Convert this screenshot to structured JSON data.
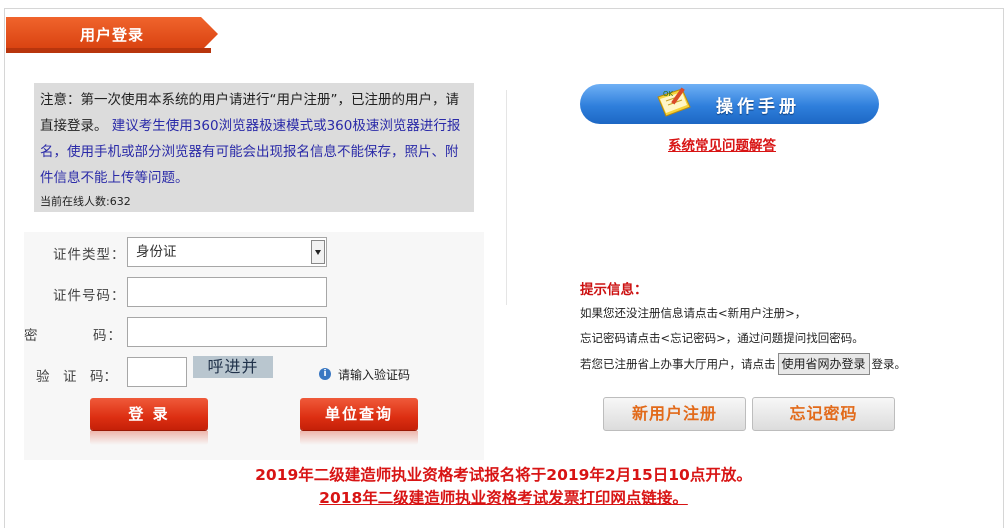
{
  "header": {
    "title": "用户登录"
  },
  "notice": {
    "text_black": "注意：第一次使用本系统的用户请进行“用户注册”，已注册的用户，请直接登录。",
    "text_blue": "建议考生使用360浏览器极速模式或360极速浏览器进行报名，使用手机或部分浏览器有可能会出现报名信息不能保存，照片、附件信息不能上传等问题。",
    "online": "当前在线人数:632"
  },
  "form": {
    "id_type_label": "证件类型：",
    "id_type_value": "身份证",
    "id_number_label": "证件号码：",
    "password_label_1": "密",
    "password_label_2": "码：",
    "captcha_label": "验　证　码：",
    "captcha_text": "呼进并",
    "captcha_hint": "请输入验证码",
    "login_button": "登 录",
    "unit_query_button": "单位查询"
  },
  "right": {
    "manual_button": "操作手册",
    "faq_link": "系统常见问题解答",
    "tip_title": "提示信息：",
    "tip_line1": "如果您还没注册信息请点击<新用户注册>，",
    "tip_line2": "忘记密码请点击<忘记密码>，通过问题提问找回密码。",
    "tip_line3_pre": "若您已注册省上办事大厅用户，请点击",
    "tip_line3_button": "使用省网办登录",
    "tip_line3_post": "登录。",
    "register_button": "新用户注册",
    "forgot_button": "忘记密码"
  },
  "announcements": {
    "line1": "2019年二级建造师执业资格考试报名将于2019年2月15日10点开放。",
    "line2": "2018年二级建造师执业资格考试发票打印网点链接。"
  },
  "colors": {
    "accent_red": "#d81414",
    "tab_orange": "#e54d18",
    "manual_blue": "#2f7fdc",
    "button_orange_text": "#e26a1a"
  }
}
